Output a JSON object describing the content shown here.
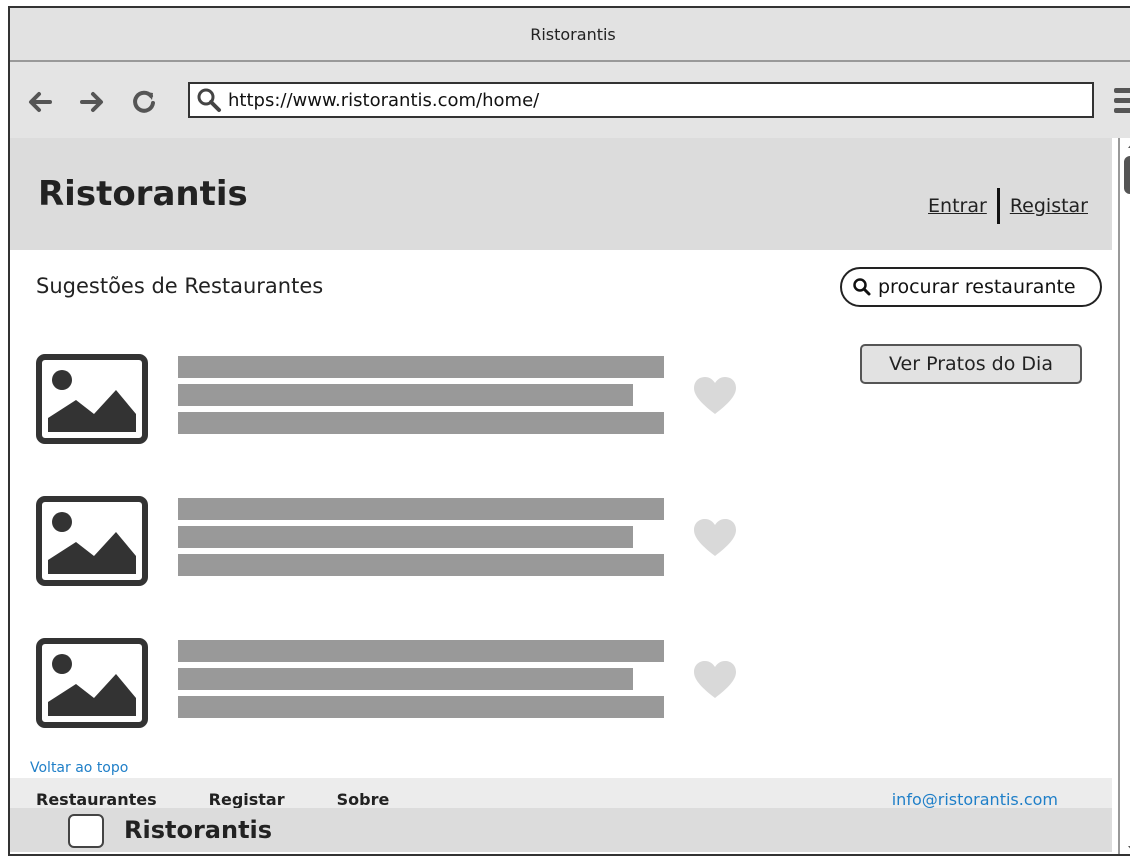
{
  "window": {
    "title": "Ristorantis"
  },
  "browser": {
    "url": "https://www.ristorantis.com/home/"
  },
  "header": {
    "logo": "Ristorantis",
    "login_label": "Entrar",
    "register_label": "Registar"
  },
  "main": {
    "section_title": "Sugestões de Restaurantes",
    "search_label": "procurar restaurante",
    "dishes_button": "Ver Pratos do Dia",
    "items": [
      {
        "image_icon": "image-placeholder-icon",
        "favorite_icon": "heart-icon"
      },
      {
        "image_icon": "image-placeholder-icon",
        "favorite_icon": "heart-icon"
      },
      {
        "image_icon": "image-placeholder-icon",
        "favorite_icon": "heart-icon"
      }
    ],
    "back_to_top": "Voltar ao topo"
  },
  "footer": {
    "links": [
      "Restaurantes",
      "Registar",
      "Sobre"
    ],
    "email": "info@ristorantis.com",
    "brand": "Ristorantis"
  },
  "colors": {
    "header_bg": "#dcdcdc",
    "link_blue": "#1f7fc8",
    "placeholder_bar": "#999999",
    "heart": "#d9d9d9"
  }
}
